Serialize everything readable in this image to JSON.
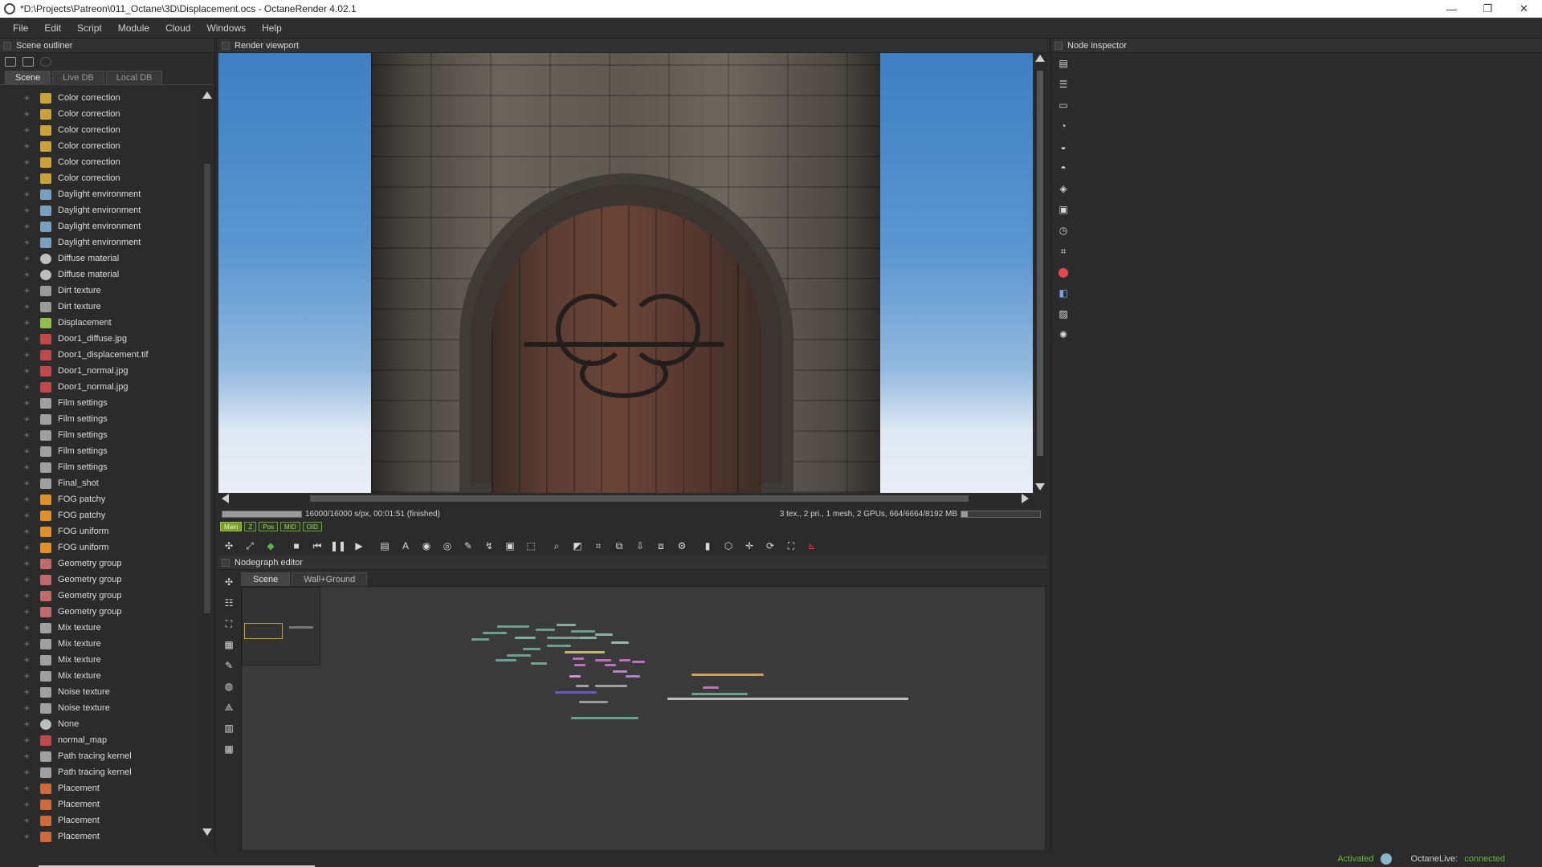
{
  "window": {
    "title": "*D:\\Projects\\Patreon\\011_Octane\\3D\\Displacement.ocs - OctaneRender 4.02.1",
    "controls": [
      "—",
      "❐",
      "✕"
    ]
  },
  "menu": [
    "File",
    "Edit",
    "Script",
    "Module",
    "Cloud",
    "Windows",
    "Help"
  ],
  "outliner": {
    "title": "Scene outliner",
    "tabs": [
      "Scene",
      "Live DB",
      "Local DB"
    ],
    "items": [
      {
        "label": "Color correction",
        "icon": "color-correction-icon",
        "color": "#c9a33a"
      },
      {
        "label": "Color correction",
        "icon": "color-correction-icon",
        "color": "#c9a33a"
      },
      {
        "label": "Color correction",
        "icon": "color-correction-icon",
        "color": "#c9a33a"
      },
      {
        "label": "Color correction",
        "icon": "color-correction-icon",
        "color": "#c9a33a"
      },
      {
        "label": "Color correction",
        "icon": "color-correction-icon",
        "color": "#c9a33a"
      },
      {
        "label": "Color correction",
        "icon": "color-correction-icon",
        "color": "#c9a33a"
      },
      {
        "label": "Daylight environment",
        "icon": "environment-icon",
        "color": "#7aa0c0"
      },
      {
        "label": "Daylight environment",
        "icon": "environment-icon",
        "color": "#7aa0c0"
      },
      {
        "label": "Daylight environment",
        "icon": "environment-icon",
        "color": "#7aa0c0"
      },
      {
        "label": "Daylight environment",
        "icon": "environment-icon",
        "color": "#7aa0c0"
      },
      {
        "label": "Diffuse material",
        "icon": "material-sphere-icon",
        "color": "#bdbdbd"
      },
      {
        "label": "Diffuse material",
        "icon": "material-sphere-icon",
        "color": "#bdbdbd"
      },
      {
        "label": "Dirt texture",
        "icon": "texture-icon",
        "color": "#9a9a9a"
      },
      {
        "label": "Dirt texture",
        "icon": "texture-icon",
        "color": "#9a9a9a"
      },
      {
        "label": "Displacement",
        "icon": "displacement-icon",
        "color": "#8fbf4a"
      },
      {
        "label": "Door1_diffuse.jpg",
        "icon": "image-texture-icon",
        "color": "#c04a4a"
      },
      {
        "label": "Door1_displacement.tif",
        "icon": "image-texture-icon",
        "color": "#c04a4a"
      },
      {
        "label": "Door1_normal.jpg",
        "icon": "image-texture-icon",
        "color": "#c04a4a"
      },
      {
        "label": "Door1_normal.jpg",
        "icon": "image-texture-icon",
        "color": "#c04a4a"
      },
      {
        "label": "Film settings",
        "icon": "film-settings-icon",
        "color": "#a0a0a0"
      },
      {
        "label": "Film settings",
        "icon": "film-settings-icon",
        "color": "#a0a0a0"
      },
      {
        "label": "Film settings",
        "icon": "film-settings-icon",
        "color": "#a0a0a0"
      },
      {
        "label": "Film settings",
        "icon": "film-settings-icon",
        "color": "#a0a0a0"
      },
      {
        "label": "Film settings",
        "icon": "film-settings-icon",
        "color": "#a0a0a0"
      },
      {
        "label": "Final_shot",
        "icon": "film-settings-icon",
        "color": "#a0a0a0"
      },
      {
        "label": "FOG patchy",
        "icon": "fog-icon",
        "color": "#e0902a"
      },
      {
        "label": "FOG patchy",
        "icon": "fog-icon",
        "color": "#e0902a"
      },
      {
        "label": "FOG uniform",
        "icon": "fog-icon",
        "color": "#e0902a"
      },
      {
        "label": "FOG uniform",
        "icon": "fog-icon",
        "color": "#e0902a"
      },
      {
        "label": "Geometry group",
        "icon": "geometry-group-icon",
        "color": "#c06a6a"
      },
      {
        "label": "Geometry group",
        "icon": "geometry-group-icon",
        "color": "#c06a6a"
      },
      {
        "label": "Geometry group",
        "icon": "geometry-group-icon",
        "color": "#c06a6a"
      },
      {
        "label": "Geometry group",
        "icon": "geometry-group-icon",
        "color": "#c06a6a"
      },
      {
        "label": "Mix texture",
        "icon": "mix-texture-icon",
        "color": "#a0a0a0"
      },
      {
        "label": "Mix texture",
        "icon": "mix-texture-icon",
        "color": "#a0a0a0"
      },
      {
        "label": "Mix texture",
        "icon": "mix-texture-icon",
        "color": "#a0a0a0"
      },
      {
        "label": "Mix texture",
        "icon": "mix-texture-icon",
        "color": "#a0a0a0"
      },
      {
        "label": "Noise texture",
        "icon": "texture-icon",
        "color": "#a0a0a0"
      },
      {
        "label": "Noise texture",
        "icon": "texture-icon",
        "color": "#a0a0a0"
      },
      {
        "label": "None",
        "icon": "material-sphere-icon",
        "color": "#bdbdbd"
      },
      {
        "label": "normal_map",
        "icon": "image-texture-icon",
        "color": "#c04a4a"
      },
      {
        "label": "Path tracing kernel",
        "icon": "kernel-icon",
        "color": "#a0a0a0"
      },
      {
        "label": "Path tracing kernel",
        "icon": "kernel-icon",
        "color": "#a0a0a0"
      },
      {
        "label": "Placement",
        "icon": "placement-icon",
        "color": "#d06a3a"
      },
      {
        "label": "Placement",
        "icon": "placement-icon",
        "color": "#d06a3a"
      },
      {
        "label": "Placement",
        "icon": "placement-icon",
        "color": "#d06a3a"
      },
      {
        "label": "Placement",
        "icon": "placement-icon",
        "color": "#d06a3a"
      }
    ]
  },
  "viewport": {
    "title": "Render viewport",
    "render_status": "16000/16000 s/px, 00:01:51 (finished)",
    "progress_fraction": 1.0,
    "gpu_info": "3 tex., 2 pri., 1 mesh, 2 GPUs, 664/6664/8192 MB",
    "gpu_memory_fraction": 0.08,
    "channel_chips": [
      "Main",
      "Z",
      "Pos",
      "MID",
      "OID"
    ],
    "toolbar": [
      {
        "name": "recenter-view-icon",
        "glyph": "✣"
      },
      {
        "name": "zoom-fit-icon",
        "glyph": "⤢"
      },
      {
        "name": "render-region-icon",
        "glyph": "◆"
      },
      {
        "name": "stop-render-icon",
        "glyph": "■"
      },
      {
        "name": "restart-render-icon",
        "glyph": "⏮"
      },
      {
        "name": "pause-render-icon",
        "glyph": "❚❚"
      },
      {
        "name": "start-render-icon",
        "glyph": "▶"
      },
      {
        "name": "real-time-mode-icon",
        "glyph": "▤"
      },
      {
        "name": "aov-icon",
        "glyph": "A"
      },
      {
        "name": "color-picker-icon",
        "glyph": "◉"
      },
      {
        "name": "lock-resolution-icon",
        "glyph": "◎"
      },
      {
        "name": "depth-of-field-icon",
        "glyph": "✎"
      },
      {
        "name": "white-balance-icon",
        "glyph": "↯"
      },
      {
        "name": "material-picker-icon",
        "glyph": "▣"
      },
      {
        "name": "object-picker-icon",
        "glyph": "⬚"
      },
      {
        "name": "zoom-icon",
        "glyph": "⌕"
      },
      {
        "name": "region-icon",
        "glyph": "◩"
      },
      {
        "name": "film-region-icon",
        "glyph": "⌗"
      },
      {
        "name": "copy-to-clipboard-icon",
        "glyph": "⧉"
      },
      {
        "name": "save-render-icon",
        "glyph": "⇩"
      },
      {
        "name": "export-passes-icon",
        "glyph": "⧈"
      },
      {
        "name": "settings-icon",
        "glyph": "⚙"
      },
      {
        "name": "clay-mode-icon",
        "glyph": "▮"
      },
      {
        "name": "viewport-box-icon",
        "glyph": "⬡"
      },
      {
        "name": "move-icon",
        "glyph": "✛"
      },
      {
        "name": "rotate-icon",
        "glyph": "⟳"
      },
      {
        "name": "fullscreen-icon",
        "glyph": "⛶"
      },
      {
        "name": "gizmo-icon",
        "glyph": "⊾"
      }
    ]
  },
  "nodegraph": {
    "title": "Nodegraph editor",
    "tabs": [
      "Scene",
      "Wall+Ground"
    ]
  },
  "inspector": {
    "title": "Node inspector"
  },
  "statusbar": {
    "activated": "Activated",
    "live_label": "OctaneLive:",
    "live_status": "connected"
  }
}
